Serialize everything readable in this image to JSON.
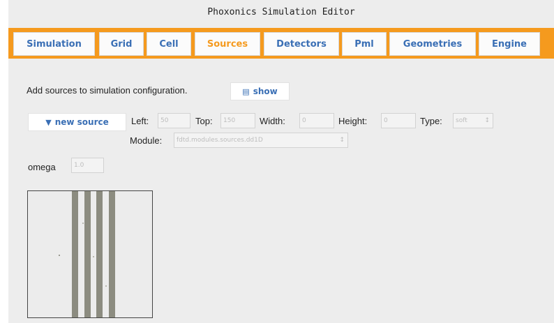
{
  "window": {
    "title": "Phoxonics Simulation Editor"
  },
  "tabs": [
    {
      "label": "Simulation",
      "active": false
    },
    {
      "label": "Grid",
      "active": false
    },
    {
      "label": "Cell",
      "active": false
    },
    {
      "label": "Sources",
      "active": true
    },
    {
      "label": "Detectors",
      "active": false
    },
    {
      "label": "Pml",
      "active": false
    },
    {
      "label": "Geometries",
      "active": false
    },
    {
      "label": "Engine",
      "active": false
    }
  ],
  "sources": {
    "description": "Add sources to simulation configuration.",
    "show_button": "show",
    "new_source_button": "new source",
    "fields": {
      "left_label": "Left:",
      "left_value": "50",
      "top_label": "Top:",
      "top_value": "150",
      "width_label": "Width:",
      "width_value": "0",
      "height_label": "Height:",
      "height_value": "0",
      "type_label": "Type:",
      "type_value": "soft",
      "module_label": "Module:",
      "module_value": "fdtd.modules.sources.dd1D"
    },
    "omega_label": "omega",
    "omega_value": "1.0"
  },
  "colors": {
    "accent": "#f59a1e",
    "tab_text": "#3a6fb5",
    "active_tab_text": "#f59a1e",
    "background": "#ededed",
    "stripe": "#8c8c80"
  },
  "icons": {
    "show": "list-icon",
    "new_source": "pin-icon",
    "dropdown": "chevron-down-icon"
  }
}
